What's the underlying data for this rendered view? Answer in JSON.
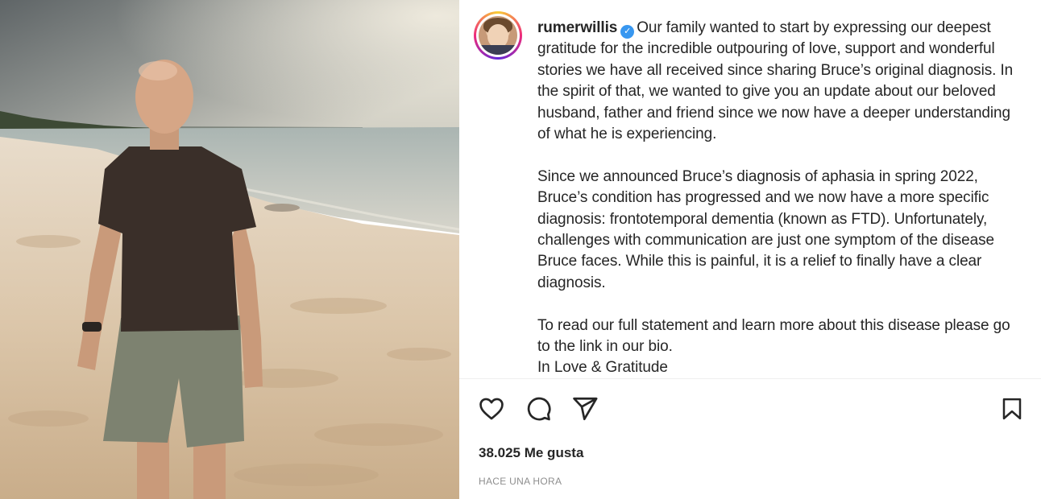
{
  "post": {
    "username": "rumerwillis",
    "verified": true,
    "caption_paragraphs": [
      "Our family wanted to start by expressing our deepest gratitude for the incredible outpouring of love, support and wonderful stories we have all received since sharing Bruce’s original diagnosis. In the spirit of that, we wanted to give you an update about our beloved husband, father and friend since we now have a deeper understanding of what he is experiencing.",
      "Since we announced Bruce’s diagnosis of aphasia in spring 2022, Bruce’s condition has progressed and we now have a more specific diagnosis: frontotemporal dementia (known as FTD). Unfortunately, challenges with communication are just one symptom of the disease Bruce faces. While this is painful, it is a relief to finally have a clear diagnosis."
    ],
    "caption_closing_line1": "To read our full statement and learn more about this disease please go to the link in our bio.",
    "caption_closing_line2": "In Love & Gratitude",
    "likes_text": "38.025 Me gusta",
    "timestamp": "HACE UNA HORA"
  },
  "icons": {
    "like": "heart-icon",
    "comment": "comment-icon",
    "share": "share-icon",
    "save": "bookmark-icon",
    "verified": "verified-badge-icon"
  },
  "colors": {
    "text": "#262626",
    "muted": "#8e8e8e",
    "verified": "#3897f0",
    "divider": "#efefef"
  }
}
